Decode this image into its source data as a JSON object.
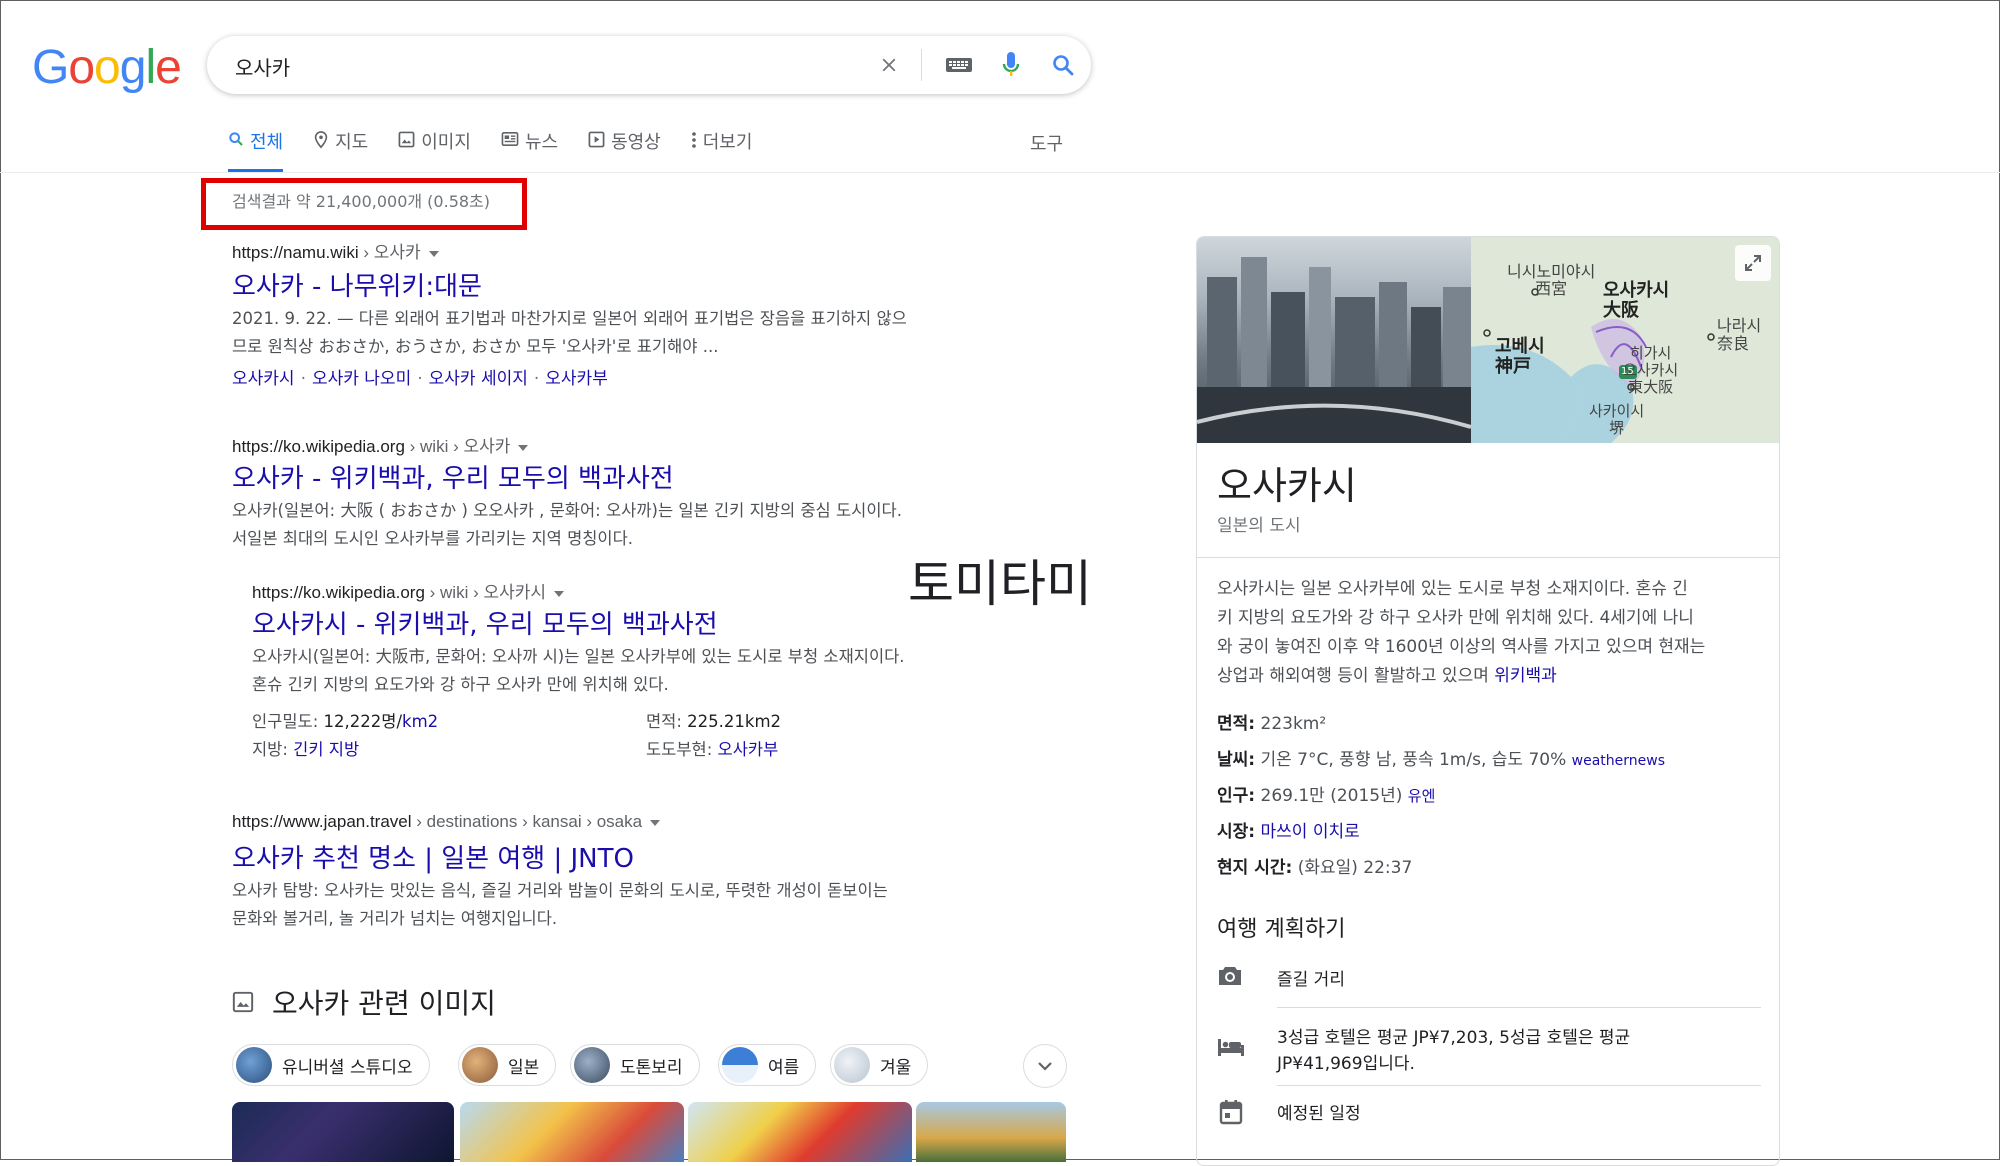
{
  "logo": {
    "letters": [
      "G",
      "o",
      "o",
      "g",
      "l",
      "e"
    ],
    "colors": [
      "#4285f4",
      "#ea4335",
      "#fbbc05",
      "#4285f4",
      "#34a853",
      "#ea4335"
    ]
  },
  "search": {
    "query": "오사카"
  },
  "tabs": [
    {
      "label": "전체",
      "icon": "search-icon"
    },
    {
      "label": "지도",
      "icon": "map-pin-icon"
    },
    {
      "label": "이미지",
      "icon": "image-icon"
    },
    {
      "label": "뉴스",
      "icon": "news-icon"
    },
    {
      "label": "동영상",
      "icon": "video-icon"
    },
    {
      "label": "더보기",
      "icon": "more-vertical-icon"
    }
  ],
  "tools_label": "도구",
  "stats": "검색결과 약 21,400,000개 (0.58초)",
  "overlay_text": "토미타미",
  "results": [
    {
      "cite_host": "https://namu.wiki",
      "cite_path": " › 오사카",
      "title": "오사카 - 나무위키:대문",
      "snippet_lines": [
        "2021. 9. 22. — 다른 외래어 표기법과 마찬가지로 일본어 외래어 표기법은 장음을 표기하지 않으",
        "므로 원칙상 おおさか, おうさか, おさか 모두 '오사카'로 표기해야 ..."
      ],
      "sitelinks": [
        "오사카시",
        "오사카 나오미",
        "오사카 세이지",
        "오사카부"
      ]
    },
    {
      "cite_host": "https://ko.wikipedia.org",
      "cite_path": " › wiki › 오사카",
      "title": "오사카 - 위키백과, 우리 모두의 백과사전",
      "snippet_lines": [
        "오사카(일본어: 大阪 ( おおさか ) 오오사카 , 문화어: 오사까)는 일본 긴키 지방의 중심 도시이다.",
        "서일본 최대의 도시인 오사카부를 가리키는 지역 명칭이다."
      ]
    },
    {
      "cite_host": "https://ko.wikipedia.org",
      "cite_path": " › wiki › 오사카시",
      "title": "오사카시 - 위키백과, 우리 모두의 백과사전",
      "snippet_lines": [
        "오사카시(일본어: 大阪市, 문화어: 오사까 시)는 일본 오사카부에 있는 도시로 부청 소재지이다.",
        "혼슈 긴키 지방의 요도가와 강 하구 오사카 만에 위치해 있다."
      ],
      "facts": {
        "density_label": "인구밀도:",
        "density_value": "12,222명/",
        "density_unit": "km2",
        "area_label": "면적:",
        "area_value": "225.21km2",
        "region_label": "지방:",
        "region_value": "긴키 지방",
        "prefecture_label": "도도부현:",
        "prefecture_value": "오사카부"
      }
    },
    {
      "cite_host": "https://www.japan.travel",
      "cite_path": " › destinations › kansai › osaka",
      "title": "오사카 추천 명소 | 일본 여행 | JNTO",
      "snippet_lines": [
        "오사카 탐방: 오사카는 맛있는 음식, 즐길 거리와 밤놀이 문화의 도시로, 뚜렷한 개성이 돋보이는",
        "문화와 볼거리, 놀 거리가 넘치는 여행지입니다."
      ]
    }
  ],
  "related_images": {
    "heading": "오사카 관련 이미지",
    "chips": [
      "유니버셜 스튜디오",
      "일본",
      "도톤보리",
      "여름",
      "겨울"
    ]
  },
  "knowledge_panel": {
    "title": "오사카시",
    "subtitle": "일본의 도시",
    "map_labels": {
      "nishinomiya": "니시노미야시",
      "nishinomiya_jp": "西宮",
      "osaka": "오사카시",
      "osaka_jp": "大阪",
      "nara": "나라시",
      "nara_jp": "奈良",
      "kobe": "고베시",
      "kobe_jp": "神戸",
      "higashiosaka": "히가시",
      "higashiosaka2": "오사카시",
      "higashiosaka_jp": "東大阪",
      "sakai": "사카이시",
      "sakai_jp": "堺",
      "route": "15"
    },
    "description_lines": [
      "오사카시는 일본 오사카부에 있는 도시로 부청 소재지이다. 혼슈 긴",
      "키 지방의 요도가와 강 하구 오사카 만에 위치해 있다. 4세기에 나니",
      "와 궁이 놓여진 이후 약 1600년 이상의 역사를 가지고 있으며 현재는",
      "상업과 해외여행 등이 활발하고 있으며"
    ],
    "description_link": "위키백과",
    "facts": {
      "area_label": "면적:",
      "area_value": "223km²",
      "weather_label": "날씨:",
      "weather_value": "기온 7°C, 풍향 남, 풍속 1m/s, 습도 70%",
      "weather_source": "weathernews",
      "population_label": "인구:",
      "population_value": "269.1만 (2015년)",
      "population_source": "유엔",
      "mayor_label": "시장:",
      "mayor_value": "마쓰이 이치로",
      "time_label": "현지 시간:",
      "time_value": "(화요일) 22:37"
    },
    "plan_heading": "여행 계획하기",
    "plan_items": [
      {
        "icon": "camera-icon",
        "text": "즐길 거리"
      },
      {
        "icon": "bed-icon",
        "text_line1": "3성급 호텔은 평균 JP¥7,203, 5성급 호텔은 평균",
        "text_line2": "JP¥41,969입니다."
      },
      {
        "icon": "calendar-icon",
        "text": "예정된 일정"
      }
    ]
  },
  "accent_color": "#1a73e8",
  "link_color": "#1a0dab",
  "highlight_box_color": "#e00000"
}
